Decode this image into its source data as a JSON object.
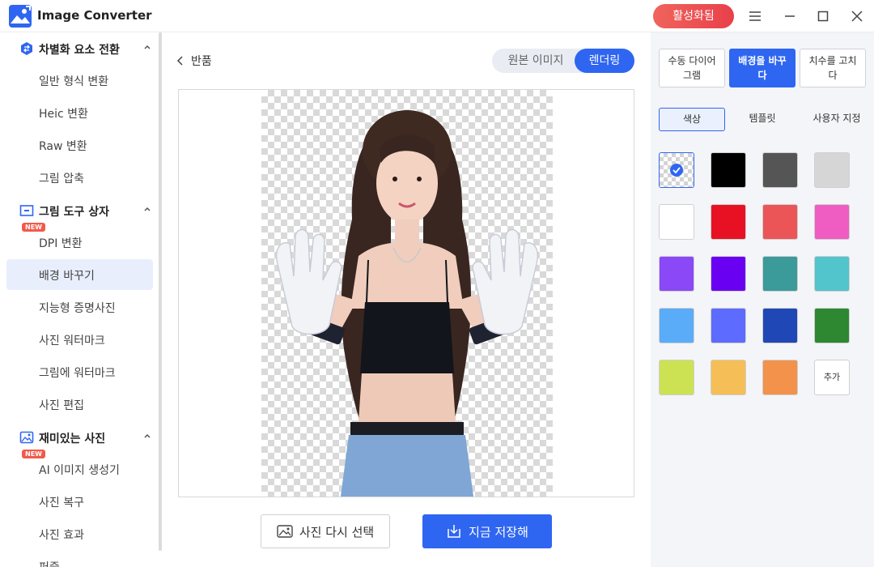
{
  "app": {
    "title": "Image Converter",
    "activate_label": "활성화됨"
  },
  "sidebar": {
    "sections": [
      {
        "label": "차별화 요소 전환",
        "icon": "convert-icon",
        "items": [
          {
            "label": "일반 형식 변환"
          },
          {
            "label": "Heic 변환"
          },
          {
            "label": "Raw 변환"
          },
          {
            "label": "그림 압축"
          }
        ]
      },
      {
        "label": "그림 도구 상자",
        "icon": "toolbox-icon",
        "items": [
          {
            "label": "DPI 변환",
            "badge": "NEW"
          },
          {
            "label": "배경 바꾸기",
            "active": true
          },
          {
            "label": "지능형 증명사진"
          },
          {
            "label": "사진 워터마크"
          },
          {
            "label": "그림에 워터마크"
          },
          {
            "label": "사진 편집"
          }
        ]
      },
      {
        "label": "재미있는 사진",
        "icon": "fun-photo-icon",
        "items": [
          {
            "label": "AI 이미지 생성기",
            "badge": "NEW"
          },
          {
            "label": "사진 복구"
          },
          {
            "label": "사진 효과"
          },
          {
            "label": "퍼즐"
          }
        ]
      }
    ]
  },
  "center": {
    "back_label": "반품",
    "toggle": {
      "original": "원본 이미지",
      "render": "렌더링",
      "active": "render"
    },
    "reselect_label": "사진 다시 선택",
    "save_label": "지금 저장해"
  },
  "right": {
    "modes": [
      {
        "label": "수동 다이어그램",
        "active": false
      },
      {
        "label": "배경을 바꾸다",
        "active": true
      },
      {
        "label": "치수를 고치다",
        "active": false
      }
    ],
    "subtabs": [
      {
        "label": "색상",
        "active": true
      },
      {
        "label": "템플릿",
        "active": false
      },
      {
        "label": "사용자 지정",
        "active": false
      }
    ],
    "swatches": [
      "transparent",
      "#000000",
      "#555555",
      "#d6d6d6",
      "#ffffff",
      "#e81123",
      "#ec5558",
      "#ef5dc3",
      "#8b48f7",
      "#6a00f2",
      "#3b9a9a",
      "#52c4cc",
      "#5aacf9",
      "#5d6bff",
      "#1f47b6",
      "#2d8831",
      "#cde253",
      "#f5be56",
      "#f3924a"
    ],
    "selected_swatch": "transparent",
    "add_label": "추가"
  }
}
